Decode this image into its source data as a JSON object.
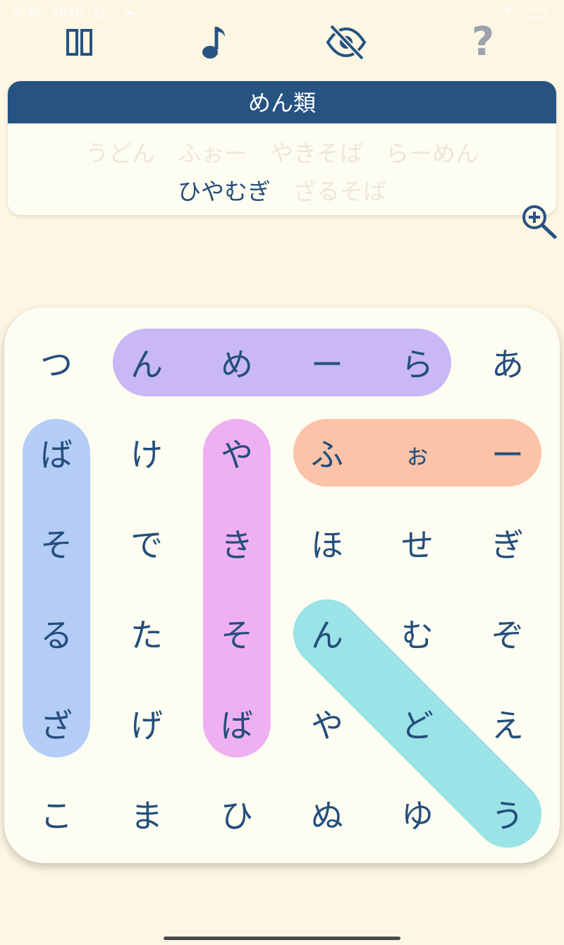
{
  "status_bar": {
    "time": "23:34",
    "date": "2月7日 (土)",
    "cloud": "☁ ···",
    "airplane": "✈",
    "battery": "EX"
  },
  "toolbar": {
    "pause_icon": "pause-icon",
    "music_icon": "music-note-icon",
    "hide_icon": "eye-slash-icon",
    "help_label": "?"
  },
  "puzzle": {
    "category": "めん類",
    "words_row1": [
      {
        "text": "うどん",
        "found": true
      },
      {
        "text": "ふぉー",
        "found": true
      },
      {
        "text": "やきそば",
        "found": true
      },
      {
        "text": "らーめん",
        "found": true
      }
    ],
    "words_row2": [
      {
        "text": "ひやむぎ",
        "found": false
      },
      {
        "text": "ざるそば",
        "found": true
      }
    ]
  },
  "zoom_icon": "zoom-in-icon",
  "colors": {
    "background": "#fdf6e3",
    "accent": "#265382",
    "text": "#244e7c",
    "highlight_purple": "#c9b8f5",
    "highlight_blue": "#b3cdf7",
    "highlight_pink": "#efb0f2",
    "highlight_orange": "#fdc3a8",
    "highlight_teal": "#9ae3e6"
  },
  "grid": [
    [
      "つ",
      "ん",
      "め",
      "ー",
      "ら",
      "あ"
    ],
    [
      "ば",
      "け",
      "や",
      "ふ",
      "ぉ",
      "ー"
    ],
    [
      "そ",
      "で",
      "き",
      "ほ",
      "せ",
      "ぎ"
    ],
    [
      "る",
      "た",
      "そ",
      "ん",
      "む",
      "ぞ"
    ],
    [
      "ざ",
      "げ",
      "ば",
      "や",
      "ど",
      "え"
    ],
    [
      "こ",
      "ま",
      "ひ",
      "ぬ",
      "ゆ",
      "う"
    ]
  ],
  "found_words": [
    {
      "word": "らーめん",
      "color": "#c9b8f5",
      "from": [
        0,
        1
      ],
      "to": [
        0,
        4
      ]
    },
    {
      "word": "ざるそば",
      "color": "#b3cdf7",
      "from": [
        1,
        0
      ],
      "to": [
        4,
        0
      ]
    },
    {
      "word": "やきそば",
      "color": "#efb0f2",
      "from": [
        1,
        2
      ],
      "to": [
        4,
        2
      ]
    },
    {
      "word": "ふぉー",
      "color": "#fdc3a8",
      "from": [
        1,
        3
      ],
      "to": [
        1,
        5
      ]
    },
    {
      "word": "うどん",
      "color": "#9ae3e6",
      "from": [
        3,
        3
      ],
      "to": [
        5,
        5
      ]
    }
  ]
}
